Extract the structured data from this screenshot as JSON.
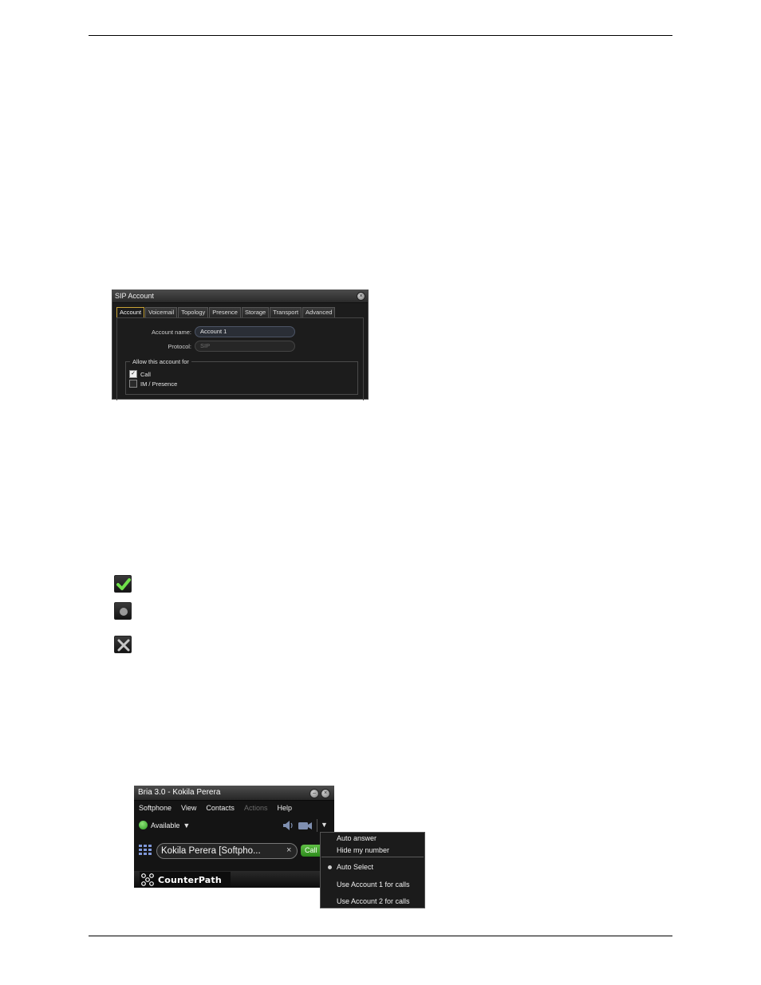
{
  "sip_dialog": {
    "title": "SIP Account",
    "tabs": [
      "Account",
      "Voicemail",
      "Topology",
      "Presence",
      "Storage",
      "Transport",
      "Advanced"
    ],
    "active_tab": "Account",
    "account_name_label": "Account name:",
    "account_name_value": "Account 1",
    "protocol_label": "Protocol:",
    "protocol_value": "SIP",
    "allow_group_label": "Allow this account for",
    "options": [
      {
        "label": "Call",
        "checked": true
      },
      {
        "label": "IM / Presence",
        "checked": false
      }
    ]
  },
  "status_icons": [
    "check-icon",
    "dot-icon",
    "x-icon"
  ],
  "bria": {
    "title": "Bria 3.0 - Kokila Perera",
    "menu": [
      {
        "label": "Softphone",
        "enabled": true
      },
      {
        "label": "View",
        "enabled": true
      },
      {
        "label": "Contacts",
        "enabled": true
      },
      {
        "label": "Actions",
        "enabled": false
      },
      {
        "label": "Help",
        "enabled": true
      }
    ],
    "status": "Available",
    "dial_value": "Kokila Perera [Softpho...",
    "call_label": "Call",
    "logo": "CounterPath",
    "accent_green": "#3aa52a"
  },
  "dropdown": {
    "items": [
      "Auto answer",
      "Hide my number",
      "Auto Select",
      "Use Account 1 for calls",
      "Use Account 2 for calls"
    ],
    "selected": "Auto Select"
  }
}
